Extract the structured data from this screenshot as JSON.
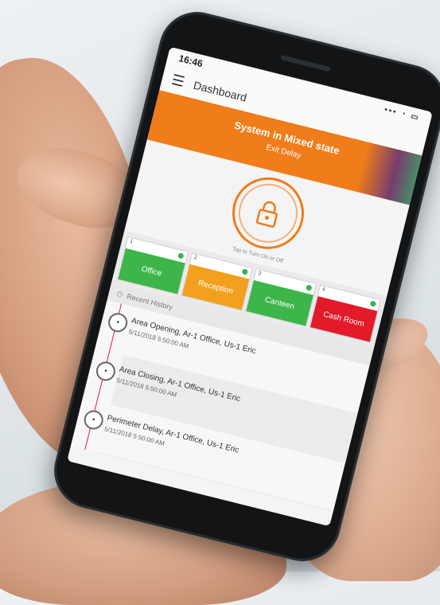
{
  "status_bar": {
    "time": "16:46",
    "icons": "••• ◔ ▭"
  },
  "app_bar": {
    "menu_icon": "hamburger-icon",
    "title": "Dashboard"
  },
  "banner": {
    "state_text": "System in Mixed state",
    "sub_text": "Exit Delay",
    "color": "#f07c1a"
  },
  "lock": {
    "icon": "lock-icon",
    "hint": "Tap to Turn On or Off"
  },
  "areas": [
    {
      "number": "1",
      "name": "Office",
      "color": "#3db54a"
    },
    {
      "number": "2",
      "name": "Reception",
      "color": "#f2a01e"
    },
    {
      "number": "3",
      "name": "Canteen",
      "color": "#3db54a"
    },
    {
      "number": "4",
      "name": "Cash Room",
      "color": "#e21a2a"
    }
  ],
  "history": {
    "title": "Recent History",
    "entries": [
      {
        "title": "Area Opening, Ar-1 Office, Us-1 Eric",
        "time": "5/11/2018 5:50:00 AM"
      },
      {
        "title": "Area Closing, Ar-1 Office, Us-1 Eric",
        "time": "5/11/2018 5:50:00 AM"
      },
      {
        "title": "Perimeter Delay, Ar-1 Office, Us-1 Eric",
        "time": "5/11/2018 5:50:00 AM"
      }
    ]
  }
}
